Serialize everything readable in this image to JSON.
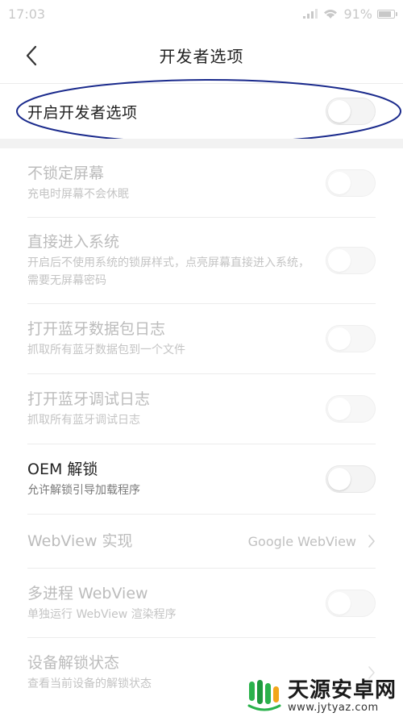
{
  "status_bar": {
    "time": "17:03",
    "battery": "91%",
    "battery_level": 0.91
  },
  "header": {
    "back_icon": "chevron-left-icon",
    "title": "开发者选项"
  },
  "master": {
    "label": "开启开发者选项",
    "enabled": false
  },
  "settings": [
    {
      "title": "不锁定屏幕",
      "subtitle": "充电时屏幕不会休眠",
      "control": "toggle",
      "enabled": false
    },
    {
      "title": "直接进入系统",
      "subtitle": "开启后不使用系统的锁屏样式，点亮屏幕直接进入系统，需要无屏幕密码",
      "control": "toggle",
      "enabled": false
    },
    {
      "title": "打开蓝牙数据包日志",
      "subtitle": "抓取所有蓝牙数据包到一个文件",
      "control": "toggle",
      "enabled": false
    },
    {
      "title": "打开蓝牙调试日志",
      "subtitle": "抓取所有蓝牙调试日志",
      "control": "toggle",
      "enabled": false
    },
    {
      "title": "OEM 解锁",
      "subtitle": "允许解锁引导加载程序",
      "control": "toggle",
      "enabled": true
    },
    {
      "title": "WebView 实现",
      "subtitle": "",
      "control": "value",
      "value": "Google WebView",
      "enabled": false
    },
    {
      "title": "多进程 WebView",
      "subtitle": "单独运行 WebView 渲染程序",
      "control": "toggle",
      "enabled": false
    },
    {
      "title": "设备解锁状态",
      "subtitle": "查看当前设备的解锁状态",
      "control": "chevron",
      "enabled": false
    }
  ],
  "watermark": {
    "title": "天源安卓网",
    "url": "www.jytyaz.com"
  },
  "colors": {
    "highlight": "#1a2a8c",
    "disabled_text": "#bcbcbc",
    "primary_text": "#222222"
  }
}
